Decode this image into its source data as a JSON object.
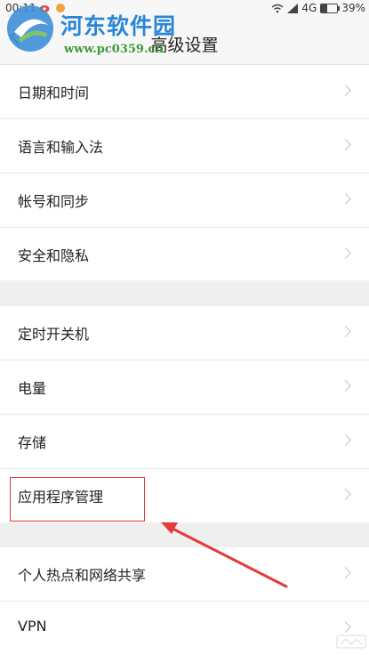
{
  "status_bar": {
    "time": "00:11",
    "network": "4G",
    "battery": "39%",
    "battery_level": 0.39
  },
  "header": {
    "title": "高级设置"
  },
  "watermark": {
    "name": "河东软件园",
    "url": "www.pc0359.cn"
  },
  "groups": [
    {
      "items": [
        {
          "label": "日期和时间"
        },
        {
          "label": "语言和输入法"
        },
        {
          "label": "帐号和同步"
        },
        {
          "label": "安全和隐私"
        }
      ]
    },
    {
      "items": [
        {
          "label": "定时开关机"
        },
        {
          "label": "电量"
        },
        {
          "label": "存储"
        },
        {
          "label": "应用程序管理"
        }
      ]
    },
    {
      "items": [
        {
          "label": "个人热点和网络共享"
        },
        {
          "label": "VPN"
        }
      ]
    }
  ],
  "icons": {
    "back": "back-arrow-icon",
    "chevron": "chevron-right-icon",
    "wifi": "wifi-icon",
    "signal": "signal-icon",
    "battery": "battery-icon"
  },
  "colors": {
    "annotation": "#e23b3b",
    "watermark_name": "#2a86d9",
    "watermark_url": "#3a9a3a"
  }
}
